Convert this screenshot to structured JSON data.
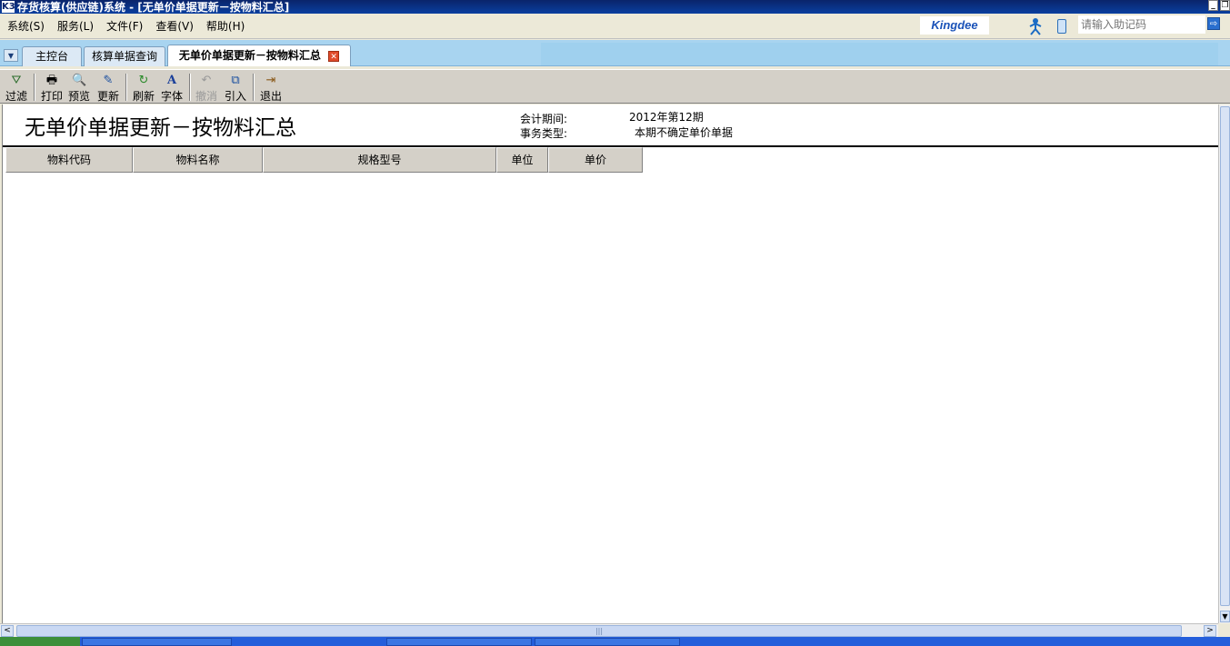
{
  "window": {
    "logo": "K3",
    "title": "存货核算(供应链)系统 - [无单价单据更新－按物料汇总]",
    "min_glyph": "_",
    "restore_glyph": "❐"
  },
  "menu": {
    "items": [
      "系统(S)",
      "服务(L)",
      "文件(F)",
      "查看(V)",
      "帮助(H)"
    ],
    "brand": "Kingdee",
    "search_placeholder": "请输入助记码",
    "search_go": "⇨"
  },
  "tabs": {
    "dropdown": "▼",
    "items": [
      {
        "label": "主控台"
      },
      {
        "label": "核算单据查询"
      },
      {
        "label": "无单价单据更新－按物料汇总"
      }
    ],
    "close_glyph": "✕"
  },
  "toolbar": {
    "buttons": [
      {
        "label": "过滤",
        "icon": "filter-icon",
        "glyph": "⛛"
      },
      {
        "label": "打印",
        "icon": "print-icon",
        "glyph": "🖶"
      },
      {
        "label": "预览",
        "icon": "preview-icon",
        "glyph": "🔍"
      },
      {
        "label": "更新",
        "icon": "update-icon",
        "glyph": "✎"
      },
      {
        "label": "刷新",
        "icon": "refresh-icon",
        "glyph": "↻"
      },
      {
        "label": "字体",
        "icon": "font-icon",
        "glyph": "A"
      },
      {
        "label": "撤消",
        "icon": "undo-icon",
        "glyph": "↶"
      },
      {
        "label": "引入",
        "icon": "import-icon",
        "glyph": "⧉"
      },
      {
        "label": "退出",
        "icon": "exit-icon",
        "glyph": "⇥"
      }
    ]
  },
  "report": {
    "title": "无单价单据更新－按物料汇总",
    "period_label": "会计期间:",
    "period_value": "2012年第12期",
    "type_label": "事务类型:",
    "type_value": "本期不确定单价单据"
  },
  "grid": {
    "columns": [
      "物料代码",
      "物料名称",
      "规格型号",
      "单位",
      "单价"
    ]
  },
  "scroll": {
    "left": "<",
    "right": ">",
    "down": "▼",
    "grip": "|||"
  },
  "colors": {
    "titlebar": "#0a246a",
    "tabstrip": "#a8d4f0",
    "toolbar": "#d4d0c8",
    "taskbar": "#245edb"
  }
}
